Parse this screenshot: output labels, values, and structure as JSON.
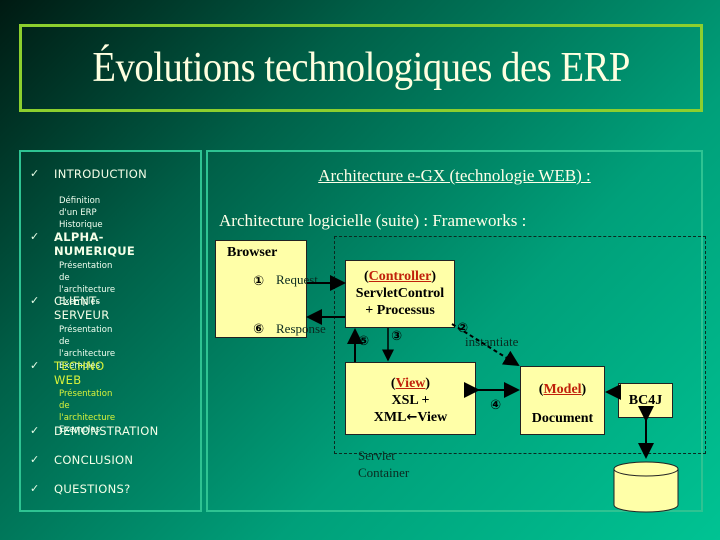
{
  "title": "Évolutions technologiques des ERP",
  "sidebar": {
    "check_icon": "✓",
    "sections": [
      {
        "label": "INTRODUCTION",
        "active": false,
        "subitems": [
          "Définition d'un ERP",
          "Historique"
        ]
      },
      {
        "label": "ALPHA-NUMERIQUE",
        "active": false,
        "subitems": [
          "Présentation de l'architecture",
          "Exemples"
        ]
      },
      {
        "label": "CLIENT-SERVEUR",
        "active": false,
        "subitems": [
          "Présentation de l'architecture",
          "Exemples"
        ]
      },
      {
        "label": "TECHNO WEB",
        "active": true,
        "subitems": [
          "Présentation de l'architecture",
          "Exemples"
        ]
      },
      {
        "label": "DEMONSTRATION",
        "active": false,
        "subitems": []
      },
      {
        "label": "CONCLUSION",
        "active": false,
        "subitems": []
      },
      {
        "label": "QUESTIONS?",
        "active": false,
        "subitems": []
      }
    ]
  },
  "main": {
    "heading": "Architecture e-GX (technologie WEB) :",
    "subheading": "Architecture logicielle (suite) : Frameworks :",
    "diagram": {
      "browser": {
        "label": "Browser"
      },
      "controller": {
        "role": "Controller",
        "line1": "ServletControl",
        "line2": "+ Processus"
      },
      "view": {
        "role": "View",
        "line1": "XSL +",
        "line2": "XML",
        "line2_arrow": "🡐",
        "line2_tail": "View"
      },
      "model": {
        "role": "Model",
        "line1": "Document"
      },
      "bc4j": {
        "label": "BC4J"
      },
      "database_icon": "database-cylinder",
      "container_label_1": "Servlet",
      "container_label_2": "Container",
      "edges": {
        "request": "Request",
        "response": "Response",
        "instantiate": "instantiate"
      },
      "steps": {
        "s1": "①",
        "s2": "②",
        "s3": "③",
        "s4": "④",
        "s5": "⑤",
        "s6": "⑥"
      }
    }
  },
  "colors": {
    "title_border": "#8ccf2e",
    "active_section": "#d8f23a",
    "box_fill": "#ffffa8",
    "role_red": "#c0200a"
  }
}
